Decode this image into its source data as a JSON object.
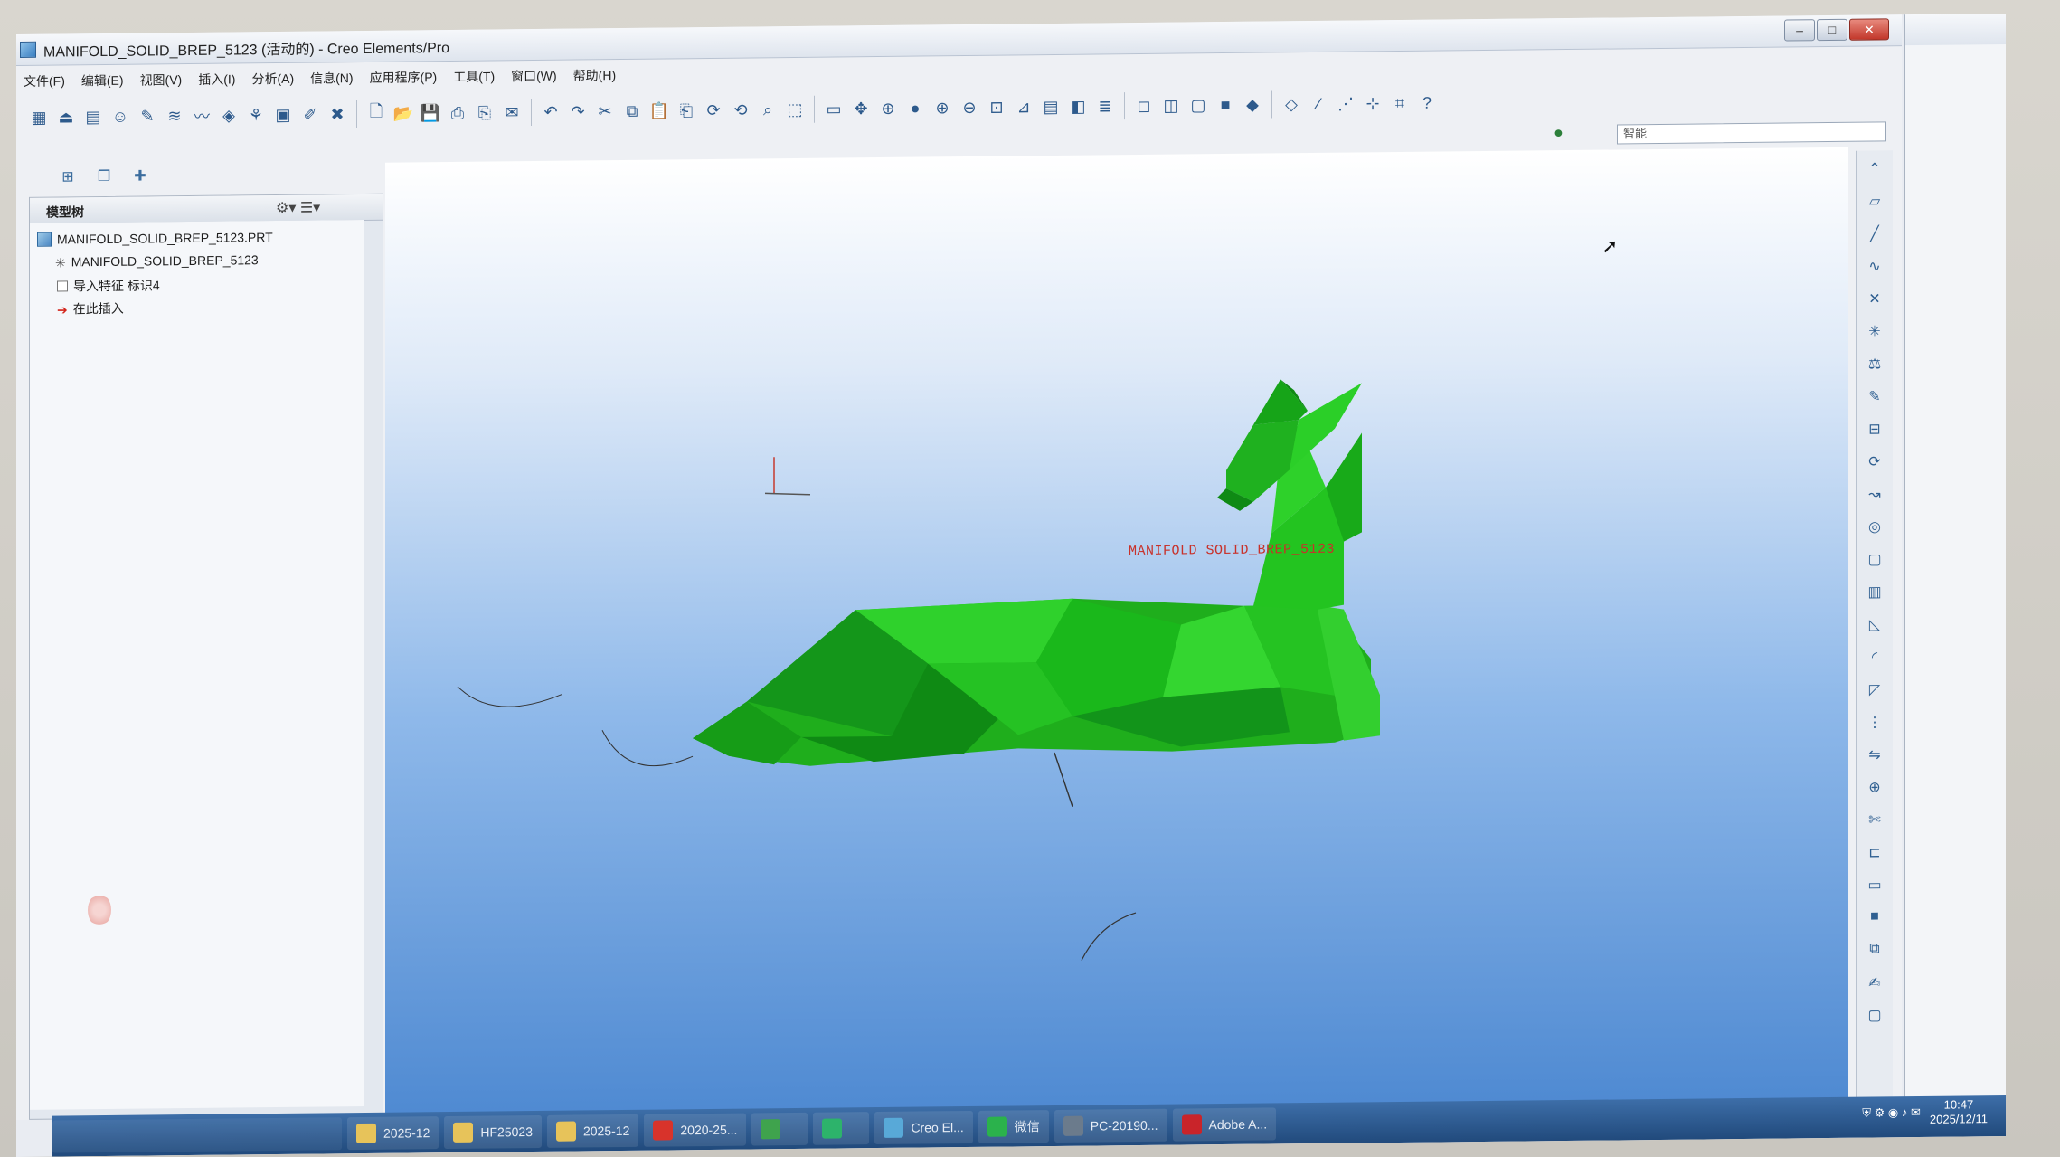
{
  "window": {
    "title": "MANIFOLD_SOLID_BREP_5123 (活动的) - Creo Elements/Pro",
    "min_label": "–",
    "max_label": "□",
    "close_label": "✕"
  },
  "menu": [
    "文件(F)",
    "编辑(E)",
    "视图(V)",
    "插入(I)",
    "分析(A)",
    "信息(N)",
    "应用程序(P)",
    "工具(T)",
    "窗口(W)",
    "帮助(H)"
  ],
  "toolbar_icons": [
    "table-icon",
    "drawing-icon",
    "grid-icon",
    "person-icon",
    "sketch-icon",
    "layer-icon",
    "spline-icon",
    "color-icon",
    "render-icon",
    "doc-icon",
    "note-icon",
    "wrench-icon",
    "new-icon",
    "open-icon",
    "save-icon",
    "print-icon",
    "print-preview-icon",
    "mail-icon",
    "undo-icon",
    "redo-icon",
    "cut-icon",
    "copy-icon",
    "paste-icon",
    "paste-special-icon",
    "regen-icon",
    "regen-manager-icon",
    "find-icon",
    "select-box-icon",
    "repaint-icon",
    "spin-center-icon",
    "orient-icon",
    "shade-icon",
    "zoom-in-icon",
    "zoom-out-icon",
    "refit-icon",
    "view-manager-icon",
    "saved-views-icon",
    "section-icon",
    "layers-icon",
    "wireframe-icon",
    "hidden-line-icon",
    "no-hidden-icon",
    "shading-icon",
    "appearance-icon",
    "datum-plane-icon",
    "datum-axis-icon",
    "datum-point-icon",
    "datum-csys-icon",
    "annotation-icon",
    "whats-this-icon"
  ],
  "search": {
    "placeholder": "智能"
  },
  "panel": {
    "title": "模型树",
    "tree": [
      {
        "label": "MANIFOLD_SOLID_BREP_5123.PRT",
        "icon": "part-icon"
      },
      {
        "label": "MANIFOLD_SOLID_BREP_5123",
        "icon": "csys-icon"
      },
      {
        "label": "导入特征 标识4",
        "icon": "import-feature-icon"
      },
      {
        "label": "在此插入",
        "icon": "insert-here-icon"
      }
    ]
  },
  "graphics": {
    "model_label": "MANIFOLD_SOLID_BREP_5123",
    "model_color": "#1fb11f"
  },
  "taskbar": {
    "items": [
      {
        "label": "2025-12",
        "icon": "folder-icon",
        "color": "#e7c35a"
      },
      {
        "label": "HF25023",
        "icon": "folder-icon",
        "color": "#e7c35a"
      },
      {
        "label": "2025-12",
        "icon": "folder-icon",
        "color": "#e7c35a"
      },
      {
        "label": "2020-25...",
        "icon": "wps-icon",
        "color": "#d8332b"
      },
      {
        "label": "",
        "icon": "apps-icon",
        "color": "#3fa34d"
      },
      {
        "label": "",
        "icon": "player-icon",
        "color": "#2db36b"
      },
      {
        "label": "Creo El...",
        "icon": "creo-icon",
        "color": "#58a9d8"
      },
      {
        "label": "微信",
        "icon": "wechat-icon",
        "color": "#2bb24c"
      },
      {
        "label": "PC-20190...",
        "icon": "remote-icon",
        "color": "#6b7b8c"
      },
      {
        "label": "Adobe A...",
        "icon": "adobe-icon",
        "color": "#c9242a"
      }
    ],
    "time": "10:47",
    "date": "2025/12/11"
  }
}
